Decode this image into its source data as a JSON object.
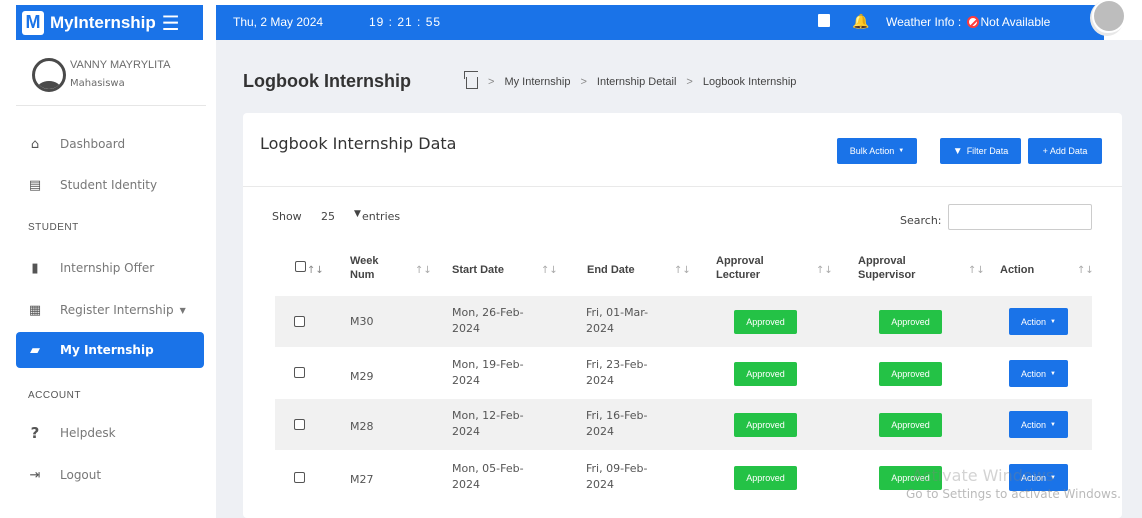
{
  "brand": {
    "logo_letter": "M",
    "name": "MyInternship",
    "menu_icon": "hamburger-icon"
  },
  "topbar": {
    "date": "Thu, 2 May 2024",
    "time": "19 : 21 : 55",
    "weather_label": "Weather Info :",
    "weather_value": "Not Available",
    "weather_icon": "no-entry-icon"
  },
  "user": {
    "name": "VANNY MAYRYLITA",
    "role": "Mahasiswa"
  },
  "sidebar": {
    "items": [
      {
        "label": "Dashboard",
        "icon": "home-icon"
      },
      {
        "label": "Student Identity",
        "icon": "id-card-icon"
      },
      {
        "label": "Internship Offer",
        "icon": "clipboard-icon"
      },
      {
        "label": "Register Internship",
        "icon": "form-icon"
      },
      {
        "label": "My Internship",
        "icon": "briefcase-icon",
        "active": true
      },
      {
        "label": "Helpdesk",
        "icon": "question-icon"
      },
      {
        "label": "Logout",
        "icon": "logout-icon"
      }
    ],
    "sections": [
      "STUDENT",
      "ACCOUNT"
    ]
  },
  "page": {
    "title": "Logbook Internship",
    "breadcrumb": [
      "My Internship",
      "Internship Detail",
      "Logbook Internship"
    ]
  },
  "card": {
    "title": "Logbook Internship Data",
    "bulk_action": "Bulk Action",
    "filter": "Filter Data",
    "add": "+ Add Data",
    "show": "Show",
    "entries_value": "25",
    "entries": "entries",
    "search": "Search:"
  },
  "table": {
    "headers": {
      "week_1": "Week",
      "week_2": "Num",
      "start": "Start Date",
      "end": "End Date",
      "lect_1": "Approval",
      "lect_2": "Lecturer",
      "sup_1": "Approval",
      "sup_2": "Supervisor",
      "action": "Action"
    },
    "rows": [
      {
        "week": "M30",
        "start_1": "Mon, 26-Feb-",
        "start_2": "2024",
        "end_1": "Fri, 01-Mar-",
        "end_2": "2024",
        "lecturer": "Approved",
        "supervisor": "Approved",
        "action": "Action"
      },
      {
        "week": "M29",
        "start_1": "Mon, 19-Feb-",
        "start_2": "2024",
        "end_1": "Fri, 23-Feb-",
        "end_2": "2024",
        "lecturer": "Approved",
        "supervisor": "Approved",
        "action": "Action"
      },
      {
        "week": "M28",
        "start_1": "Mon, 12-Feb-",
        "start_2": "2024",
        "end_1": "Fri, 16-Feb-",
        "end_2": "2024",
        "lecturer": "Approved",
        "supervisor": "Approved",
        "action": "Action"
      },
      {
        "week": "M27",
        "start_1": "Mon, 05-Feb-",
        "start_2": "2024",
        "end_1": "Fri, 09-Feb-",
        "end_2": "2024",
        "lecturer": "Approved",
        "supervisor": "Approved",
        "action": "Action"
      }
    ]
  },
  "watermark": {
    "line1": "Activate Windows",
    "line2": "Go to Settings to activate Windows."
  },
  "colors": {
    "primary": "#1a73e8",
    "approved": "#24c246",
    "background": "#eef0f4"
  }
}
